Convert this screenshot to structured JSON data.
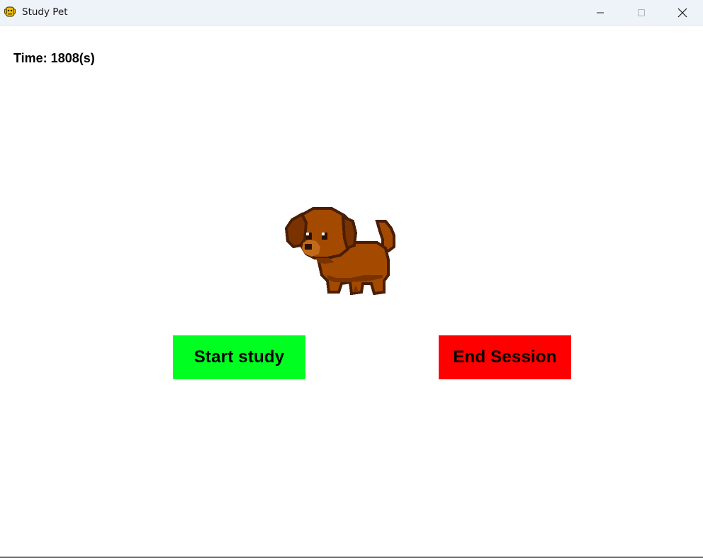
{
  "window": {
    "title": "Study Pet",
    "app_icon": "pet-app-icon",
    "controls": [
      "minimize-icon",
      "maximize-icon",
      "close-icon"
    ]
  },
  "timer": {
    "text": "Time: 1808(s)"
  },
  "pet": {
    "icon": "dog-sprite"
  },
  "buttons": {
    "start_label": "Start study",
    "end_label": "End Session"
  },
  "colors": {
    "start_bg": "#00ff21",
    "end_bg": "#ff0000",
    "titlebar_bg": "#eef3f9",
    "pet_brown": "#a34a00",
    "pet_outline": "#4a1e05"
  }
}
